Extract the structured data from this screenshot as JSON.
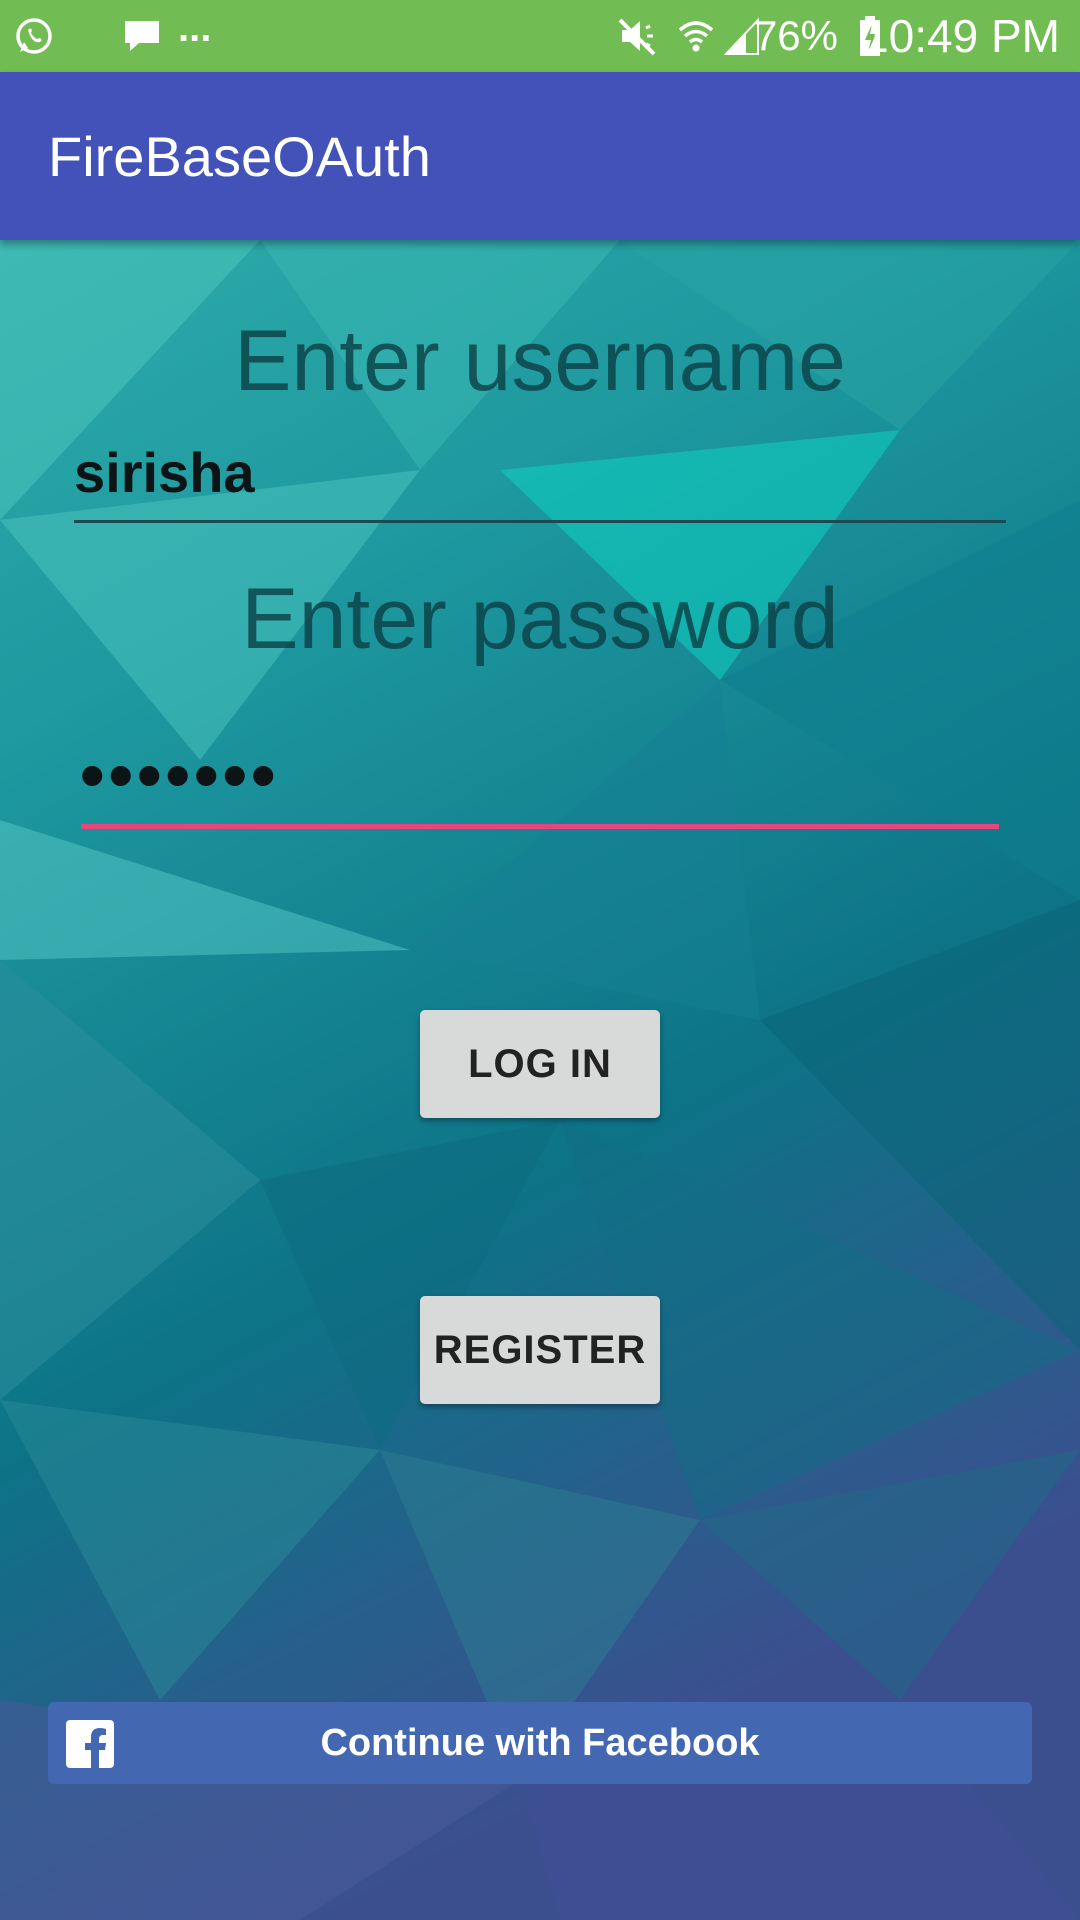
{
  "status_bar": {
    "time": "10:49 PM",
    "battery_percent": "76%",
    "overflow_indicator": "...",
    "icons": [
      "whatsapp-icon",
      "message-icon",
      "mute-icon",
      "wifi-icon",
      "cell-signal-icon",
      "battery-charging-icon"
    ]
  },
  "app_bar": {
    "title": "FireBaseOAuth"
  },
  "form": {
    "username_prompt": "Enter username",
    "username_value": "sirisha",
    "password_prompt": "Enter password",
    "password_value": "•••••••"
  },
  "buttons": {
    "login": "LOG IN",
    "register": "REGISTER",
    "facebook": "Continue with Facebook"
  },
  "colors": {
    "status_bar": "#72bd53",
    "app_bar": "#4252b8",
    "accent_underline": "#e8457f",
    "facebook_blue": "#4467b1"
  }
}
